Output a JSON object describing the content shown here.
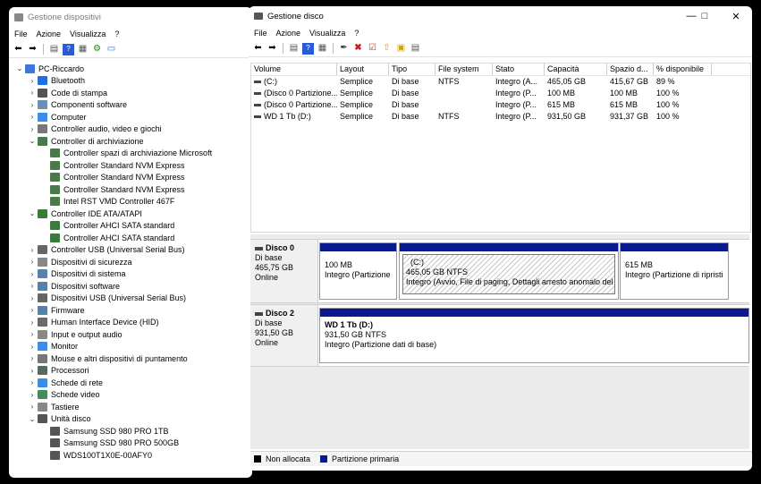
{
  "device_manager": {
    "title": "Gestione dispositivi",
    "menu": [
      "File",
      "Azione",
      "Visualizza",
      "?"
    ],
    "tree": [
      {
        "label": "PC-Riccardo",
        "exp": "v",
        "indent": 0,
        "color": "#3b78d8"
      },
      {
        "label": "Bluetooth",
        "exp": ">",
        "indent": 1,
        "color": "#1f6fe0"
      },
      {
        "label": "Code di stampa",
        "exp": ">",
        "indent": 1,
        "color": "#555555"
      },
      {
        "label": "Componenti software",
        "exp": ">",
        "indent": 1,
        "color": "#6b8fb5"
      },
      {
        "label": "Computer",
        "exp": ">",
        "indent": 1,
        "color": "#3a8de0"
      },
      {
        "label": "Controller audio, video e giochi",
        "exp": ">",
        "indent": 1,
        "color": "#777777"
      },
      {
        "label": "Controller di archiviazione",
        "exp": "v",
        "indent": 1,
        "color": "#4a7a4a"
      },
      {
        "label": "Controller spazi di archiviazione Microsoft",
        "exp": "",
        "indent": 2,
        "color": "#4a7a4a"
      },
      {
        "label": "Controller Standard NVM Express",
        "exp": "",
        "indent": 2,
        "color": "#4a7a4a"
      },
      {
        "label": "Controller Standard NVM Express",
        "exp": "",
        "indent": 2,
        "color": "#4a7a4a"
      },
      {
        "label": "Controller Standard NVM Express",
        "exp": "",
        "indent": 2,
        "color": "#4a7a4a"
      },
      {
        "label": "Intel RST VMD Controller 467F",
        "exp": "",
        "indent": 2,
        "color": "#4a7a4a"
      },
      {
        "label": "Controller IDE ATA/ATAPI",
        "exp": "v",
        "indent": 1,
        "color": "#3a7a3a"
      },
      {
        "label": "Controller AHCI SATA standard",
        "exp": "",
        "indent": 2,
        "color": "#3a7a3a"
      },
      {
        "label": "Controller AHCI SATA standard",
        "exp": "",
        "indent": 2,
        "color": "#3a7a3a"
      },
      {
        "label": "Controller USB (Universal Serial Bus)",
        "exp": ">",
        "indent": 1,
        "color": "#666666"
      },
      {
        "label": "Dispositivi di sicurezza",
        "exp": ">",
        "indent": 1,
        "color": "#888888"
      },
      {
        "label": "Dispositivi di sistema",
        "exp": ">",
        "indent": 1,
        "color": "#5a7fa8"
      },
      {
        "label": "Dispositivi software",
        "exp": ">",
        "indent": 1,
        "color": "#5a7fa8"
      },
      {
        "label": "Dispositivi USB (Universal Serial Bus)",
        "exp": ">",
        "indent": 1,
        "color": "#666666"
      },
      {
        "label": "Firmware",
        "exp": ">",
        "indent": 1,
        "color": "#5a7fa8"
      },
      {
        "label": "Human Interface Device (HID)",
        "exp": ">",
        "indent": 1,
        "color": "#6a6a6a"
      },
      {
        "label": "Input e output audio",
        "exp": ">",
        "indent": 1,
        "color": "#888888"
      },
      {
        "label": "Monitor",
        "exp": ">",
        "indent": 1,
        "color": "#3a8de0"
      },
      {
        "label": "Mouse e altri dispositivi di puntamento",
        "exp": ">",
        "indent": 1,
        "color": "#777777"
      },
      {
        "label": "Processori",
        "exp": ">",
        "indent": 1,
        "color": "#5a6a5a"
      },
      {
        "label": "Schede di rete",
        "exp": ">",
        "indent": 1,
        "color": "#3a8de0"
      },
      {
        "label": "Schede video",
        "exp": ">",
        "indent": 1,
        "color": "#4a8a5a"
      },
      {
        "label": "Tastiere",
        "exp": ">",
        "indent": 1,
        "color": "#888888"
      },
      {
        "label": "Unità disco",
        "exp": "v",
        "indent": 1,
        "color": "#555555"
      },
      {
        "label": "Samsung SSD 980 PRO 1TB",
        "exp": "",
        "indent": 2,
        "color": "#555555"
      },
      {
        "label": "Samsung SSD 980 PRO 500GB",
        "exp": "",
        "indent": 2,
        "color": "#555555"
      },
      {
        "label": "WDS100T1X0E-00AFY0",
        "exp": "",
        "indent": 2,
        "color": "#555555"
      }
    ]
  },
  "disk_mgmt": {
    "title": "Gestione disco",
    "menu": [
      "File",
      "Azione",
      "Visualizza",
      "?"
    ],
    "columns": [
      "Volume",
      "Layout",
      "Tipo",
      "File system",
      "Stato",
      "Capacità",
      "Spazio d...",
      "% disponibile"
    ],
    "rows": [
      [
        "(C:)",
        "Semplice",
        "Di base",
        "NTFS",
        "Integro (A...",
        "465,05 GB",
        "415,67 GB",
        "89 %"
      ],
      [
        "(Disco 0 Partizione...",
        "Semplice",
        "Di base",
        "",
        "Integro (P...",
        "100 MB",
        "100 MB",
        "100 %"
      ],
      [
        "(Disco 0 Partizione...",
        "Semplice",
        "Di base",
        "",
        "Integro (P...",
        "615 MB",
        "615 MB",
        "100 %"
      ],
      [
        "WD 1 Tb (D:)",
        "Semplice",
        "Di base",
        "NTFS",
        "Integro (P...",
        "931,50 GB",
        "931,37 GB",
        "100 %"
      ]
    ],
    "disks": [
      {
        "name": "Disco 0",
        "type": "Di base",
        "size": "465,75 GB",
        "status": "Online",
        "parts": [
          {
            "l1": "",
            "l2": "100 MB",
            "l3": "Integro (Partizione"
          },
          {
            "l1": "(C:)",
            "l2": "465,05 GB NTFS",
            "l3": "Integro (Avvio, File di paging, Dettagli arresto anomalo del s"
          },
          {
            "l1": "",
            "l2": "615 MB",
            "l3": "Integro (Partizione di ripristi"
          }
        ]
      },
      {
        "name": "Disco 2",
        "type": "Di base",
        "size": "931,50 GB",
        "status": "Online",
        "parts": [
          {
            "l1": "WD 1 Tb  (D:)",
            "l2": "931,50 GB NTFS",
            "l3": "Integro (Partizione dati di base)"
          }
        ]
      }
    ],
    "legend": {
      "unalloc": "Non allocata",
      "primary": "Partizione primaria"
    }
  },
  "colors": {
    "partition_bar": "#0a1a8c",
    "unallocated": "#000000",
    "desktop": "#000000"
  }
}
